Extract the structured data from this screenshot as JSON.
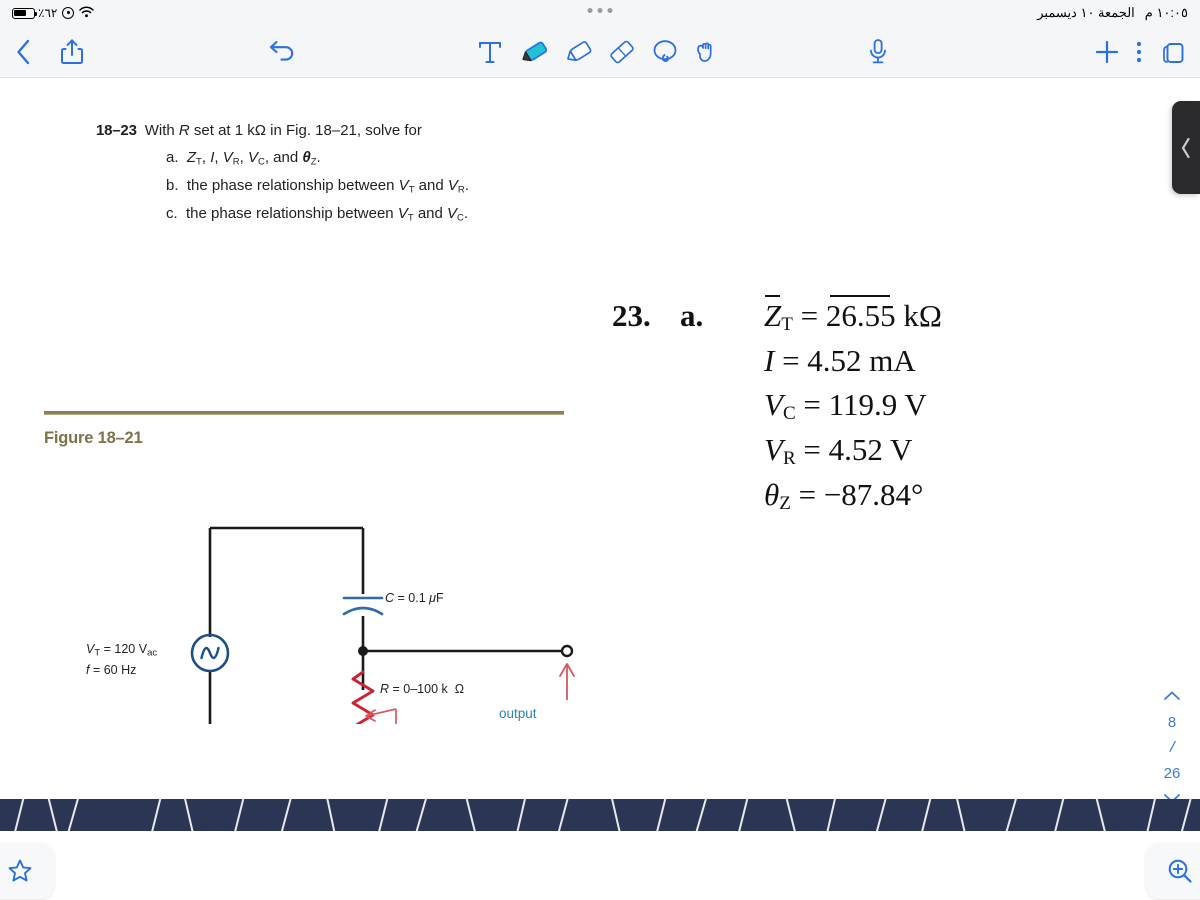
{
  "status_bar": {
    "battery_percent_label": "٪٦٢",
    "battery_level": 62,
    "location_icon": "location-icon",
    "wifi_icon": "wifi-icon",
    "date": "الجمعة ١٠ ديسمبر",
    "time": "١٠:٠٥ م",
    "multitask_handle": "multitask-dots"
  },
  "toolbar": {
    "back_icon": "back-chevron-icon",
    "share_icon": "share-icon",
    "undo_icon": "undo-icon",
    "text_tool_icon": "text-tool-icon",
    "pen_tool_icon": "pen-tool-icon",
    "highlighter_tool_icon": "highlighter-tool-icon",
    "eraser_tool_icon": "eraser-tool-icon",
    "lasso_tool_icon": "lasso-tool-icon",
    "hand_tool_icon": "hand-tool-icon",
    "mic_icon": "microphone-icon",
    "add_icon": "plus-icon",
    "more_icon": "more-vertical-icon",
    "pages_icon": "pages-icon",
    "accent_color": "#2b6fe0",
    "pen_tip_color": "#1fc2d6"
  },
  "document": {
    "problem": {
      "number": "18–23",
      "stem_pre": "With ",
      "stem_var": "R",
      "stem_post": " set at 1 kΩ in Fig. 18–21, solve for",
      "parts": [
        {
          "letter": "a.",
          "text_html": "Z_T, I, V_R, V_C, and θ_Z."
        },
        {
          "letter": "b.",
          "text": "the phase relationship between V_T and V_R."
        },
        {
          "letter": "c.",
          "text": "the phase relationship between V_T and V_C."
        }
      ]
    },
    "answer_key": {
      "problem_number": "23.",
      "part_letter": "a.",
      "lines": [
        {
          "symbol": "Z",
          "sub": "T",
          "overbar": true,
          "relation": "=",
          "value": "26.55",
          "unit": "kΩ",
          "value_overbar": true
        },
        {
          "symbol": "I",
          "sub": "",
          "overbar": false,
          "relation": "=",
          "value": "4.52",
          "unit": "mA",
          "value_overbar": false
        },
        {
          "symbol": "V",
          "sub": "C",
          "overbar": false,
          "relation": "=",
          "value": "119.9",
          "unit": "V",
          "value_overbar": false
        },
        {
          "symbol": "V",
          "sub": "R",
          "overbar": false,
          "relation": "=",
          "value": "4.52",
          "unit": "V",
          "value_overbar": false
        },
        {
          "symbol": "θ",
          "sub": "Z",
          "overbar": false,
          "relation": "=",
          "value": "−87.84°",
          "unit": "",
          "value_overbar": false
        }
      ]
    },
    "figure": {
      "caption": "Figure 18–21",
      "rule_color": "#8d7f4f",
      "caption_color": "#7d7348",
      "labels": {
        "capacitor": "C = 0.1 μF",
        "source_line1": "V_T = 120 V_ac",
        "source_line2": "f = 60 Hz",
        "resistor": "R = 0–100 k  Ω",
        "output": "output"
      },
      "colors": {
        "capacitor": "#2d6ca8",
        "source": "#1c4f87",
        "resistor": "#cf2230",
        "arrow": "#d9575f",
        "output_text": "#2d7fbd",
        "wire": "#1a1a1a"
      }
    }
  },
  "side_panel_tab": {
    "icon": "chevron-left-icon"
  },
  "page_nav": {
    "up_icon": "chevron-up-icon",
    "current_page": "8",
    "separator": "/",
    "total_pages": "26",
    "down_icon": "chevron-down-icon"
  },
  "bottom": {
    "filmstrip_color": "#2b3655",
    "bookmark_icon": "star-outline-icon",
    "zoom_icon": "zoom-in-icon"
  }
}
